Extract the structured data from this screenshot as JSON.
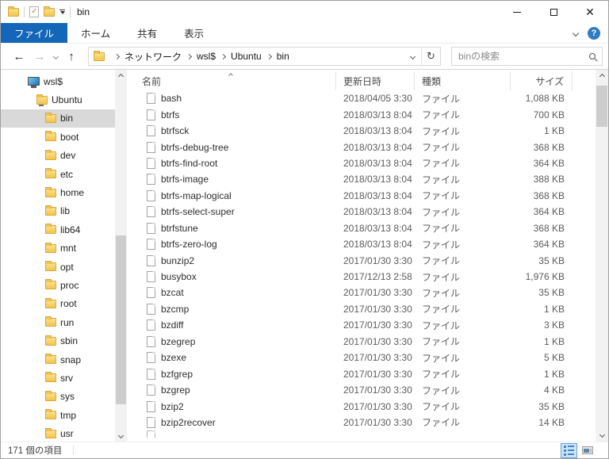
{
  "window": {
    "title": "bin"
  },
  "ribbon": {
    "tabs": [
      {
        "label": "ファイル",
        "active": true
      },
      {
        "label": "ホーム",
        "active": false
      },
      {
        "label": "共有",
        "active": false
      },
      {
        "label": "表示",
        "active": false
      }
    ]
  },
  "navbar": {
    "breadcrumbs": [
      "ネットワーク",
      "wsl$",
      "Ubuntu",
      "bin"
    ],
    "search_placeholder": "binの検索"
  },
  "sidebar": {
    "items": [
      {
        "label": "wsl$",
        "level": 0,
        "icon": "computer",
        "selected": false
      },
      {
        "label": "Ubuntu",
        "level": 1,
        "icon": "share-folder",
        "selected": false
      },
      {
        "label": "bin",
        "level": 2,
        "icon": "folder",
        "selected": true
      },
      {
        "label": "boot",
        "level": 2,
        "icon": "folder",
        "selected": false
      },
      {
        "label": "dev",
        "level": 2,
        "icon": "folder",
        "selected": false
      },
      {
        "label": "etc",
        "level": 2,
        "icon": "folder",
        "selected": false
      },
      {
        "label": "home",
        "level": 2,
        "icon": "folder",
        "selected": false
      },
      {
        "label": "lib",
        "level": 2,
        "icon": "folder",
        "selected": false
      },
      {
        "label": "lib64",
        "level": 2,
        "icon": "folder",
        "selected": false
      },
      {
        "label": "mnt",
        "level": 2,
        "icon": "folder",
        "selected": false
      },
      {
        "label": "opt",
        "level": 2,
        "icon": "folder",
        "selected": false
      },
      {
        "label": "proc",
        "level": 2,
        "icon": "folder",
        "selected": false
      },
      {
        "label": "root",
        "level": 2,
        "icon": "folder",
        "selected": false
      },
      {
        "label": "run",
        "level": 2,
        "icon": "folder",
        "selected": false
      },
      {
        "label": "sbin",
        "level": 2,
        "icon": "folder",
        "selected": false
      },
      {
        "label": "snap",
        "level": 2,
        "icon": "folder",
        "selected": false
      },
      {
        "label": "srv",
        "level": 2,
        "icon": "folder",
        "selected": false
      },
      {
        "label": "sys",
        "level": 2,
        "icon": "folder",
        "selected": false
      },
      {
        "label": "tmp",
        "level": 2,
        "icon": "folder",
        "selected": false
      },
      {
        "label": "usr",
        "level": 2,
        "icon": "folder",
        "selected": false
      }
    ]
  },
  "filelist": {
    "columns": [
      "名前",
      "更新日時",
      "種類",
      "サイズ"
    ],
    "rows": [
      {
        "name": "bash",
        "modified": "2018/04/05 3:30",
        "type": "ファイル",
        "size": "1,088 KB"
      },
      {
        "name": "btrfs",
        "modified": "2018/03/13 8:04",
        "type": "ファイル",
        "size": "700 KB"
      },
      {
        "name": "btrfsck",
        "modified": "2018/03/13 8:04",
        "type": "ファイル",
        "size": "1 KB"
      },
      {
        "name": "btrfs-debug-tree",
        "modified": "2018/03/13 8:04",
        "type": "ファイル",
        "size": "368 KB"
      },
      {
        "name": "btrfs-find-root",
        "modified": "2018/03/13 8:04",
        "type": "ファイル",
        "size": "364 KB"
      },
      {
        "name": "btrfs-image",
        "modified": "2018/03/13 8:04",
        "type": "ファイル",
        "size": "388 KB"
      },
      {
        "name": "btrfs-map-logical",
        "modified": "2018/03/13 8:04",
        "type": "ファイル",
        "size": "368 KB"
      },
      {
        "name": "btrfs-select-super",
        "modified": "2018/03/13 8:04",
        "type": "ファイル",
        "size": "364 KB"
      },
      {
        "name": "btrfstune",
        "modified": "2018/03/13 8:04",
        "type": "ファイル",
        "size": "368 KB"
      },
      {
        "name": "btrfs-zero-log",
        "modified": "2018/03/13 8:04",
        "type": "ファイル",
        "size": "364 KB"
      },
      {
        "name": "bunzip2",
        "modified": "2017/01/30 3:30",
        "type": "ファイル",
        "size": "35 KB"
      },
      {
        "name": "busybox",
        "modified": "2017/12/13 2:58",
        "type": "ファイル",
        "size": "1,976 KB"
      },
      {
        "name": "bzcat",
        "modified": "2017/01/30 3:30",
        "type": "ファイル",
        "size": "35 KB"
      },
      {
        "name": "bzcmp",
        "modified": "2017/01/30 3:30",
        "type": "ファイル",
        "size": "1 KB"
      },
      {
        "name": "bzdiff",
        "modified": "2017/01/30 3:30",
        "type": "ファイル",
        "size": "3 KB"
      },
      {
        "name": "bzegrep",
        "modified": "2017/01/30 3:30",
        "type": "ファイル",
        "size": "1 KB"
      },
      {
        "name": "bzexe",
        "modified": "2017/01/30 3:30",
        "type": "ファイル",
        "size": "5 KB"
      },
      {
        "name": "bzfgrep",
        "modified": "2017/01/30 3:30",
        "type": "ファイル",
        "size": "1 KB"
      },
      {
        "name": "bzgrep",
        "modified": "2017/01/30 3:30",
        "type": "ファイル",
        "size": "4 KB"
      },
      {
        "name": "bzip2",
        "modified": "2017/01/30 3:30",
        "type": "ファイル",
        "size": "35 KB"
      },
      {
        "name": "bzip2recover",
        "modified": "2017/01/30 3:30",
        "type": "ファイル",
        "size": "14 KB"
      }
    ]
  },
  "statusbar": {
    "item_count": "171 個の項目"
  },
  "colors": {
    "accent": "#1467b8",
    "selection": "#d9d9d9",
    "help_blue": "#2f7bc4"
  }
}
